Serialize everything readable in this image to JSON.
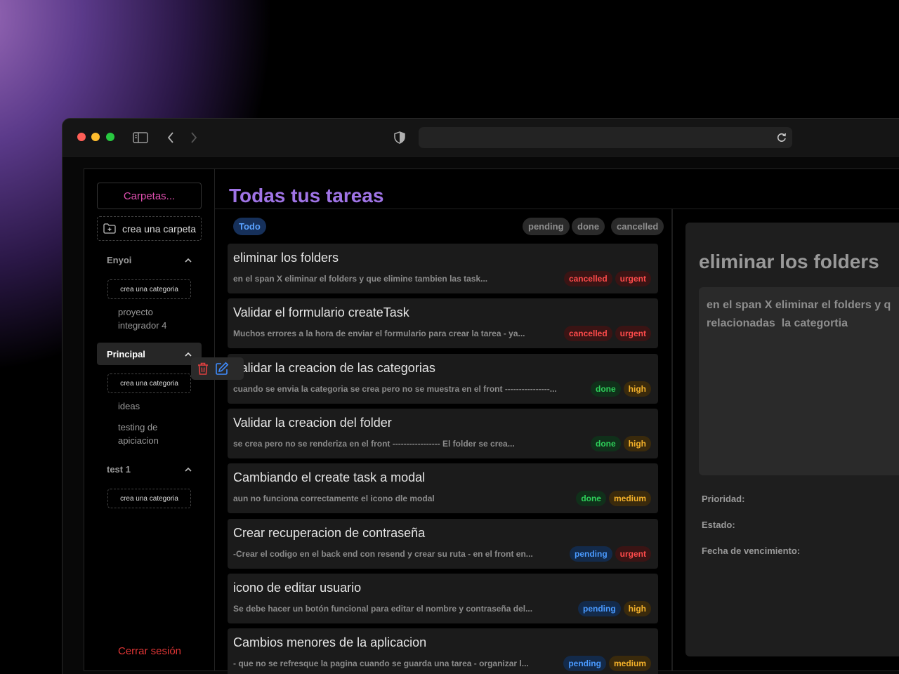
{
  "browser": {
    "url": ""
  },
  "sidebar": {
    "folders_button": "Carpetas...",
    "new_folder_label": "crea una carpeta",
    "folders": [
      {
        "name": "Enyoi",
        "new_category_label": "crea una categoria",
        "categories": [
          "proyecto integrador 4"
        ]
      },
      {
        "name": "Principal",
        "new_category_label": "crea una categoria",
        "categories": [
          "ideas",
          "testing de apiciacion"
        ]
      },
      {
        "name": "test 1",
        "new_category_label": "crea una categoria",
        "categories": []
      }
    ],
    "logout_label": "Cerrar sesión"
  },
  "main": {
    "title": "Todas tus tareas",
    "filters": {
      "active": "Todo",
      "statuses": [
        "pending",
        "done",
        "cancelled"
      ]
    },
    "tasks": [
      {
        "title": "eliminar los folders",
        "description": "en el span X eliminar el folders y que elimine tambien las task...",
        "status": "cancelled",
        "priority": "urgent"
      },
      {
        "title": "Validar el formulario createTask",
        "description": "Muchos errores a la hora de enviar el formulario para crear la tarea - ya...",
        "status": "cancelled",
        "priority": "urgent"
      },
      {
        "title": "Validar la creacion de las categorias",
        "description": "cuando se envia la categoria se crea pero no se muestra en el front ----------------...",
        "status": "done",
        "priority": "high"
      },
      {
        "title": "Validar la creacion del folder",
        "description": "se crea pero no se renderiza en el front ----------------- El folder se crea...",
        "status": "done",
        "priority": "high"
      },
      {
        "title": "Cambiando el create task a modal",
        "description": "aun no funciona correctamente el icono dle modal",
        "status": "done",
        "priority": "medium"
      },
      {
        "title": "Crear recuperacion de contraseña",
        "description": "-Crear el codigo en el back end con resend y crear su ruta - en el front en...",
        "status": "pending",
        "priority": "urgent"
      },
      {
        "title": "icono de editar usuario",
        "description": "Se debe hacer un botón funcional para editar el nombre y contraseña del...",
        "status": "pending",
        "priority": "high"
      },
      {
        "title": "Cambios menores de la aplicacion",
        "description": "- que no se refresque la pagina cuando se guarda una tarea - organizar l...",
        "status": "pending",
        "priority": "medium"
      }
    ]
  },
  "detail": {
    "title": "eliminar los folders",
    "description": "en el span X eliminar el folders y q\nrelacionadas  la categortia",
    "priority_label": "Prioridad:",
    "status_label": "Estado:",
    "due_label": "Fecha de vencimiento:"
  }
}
